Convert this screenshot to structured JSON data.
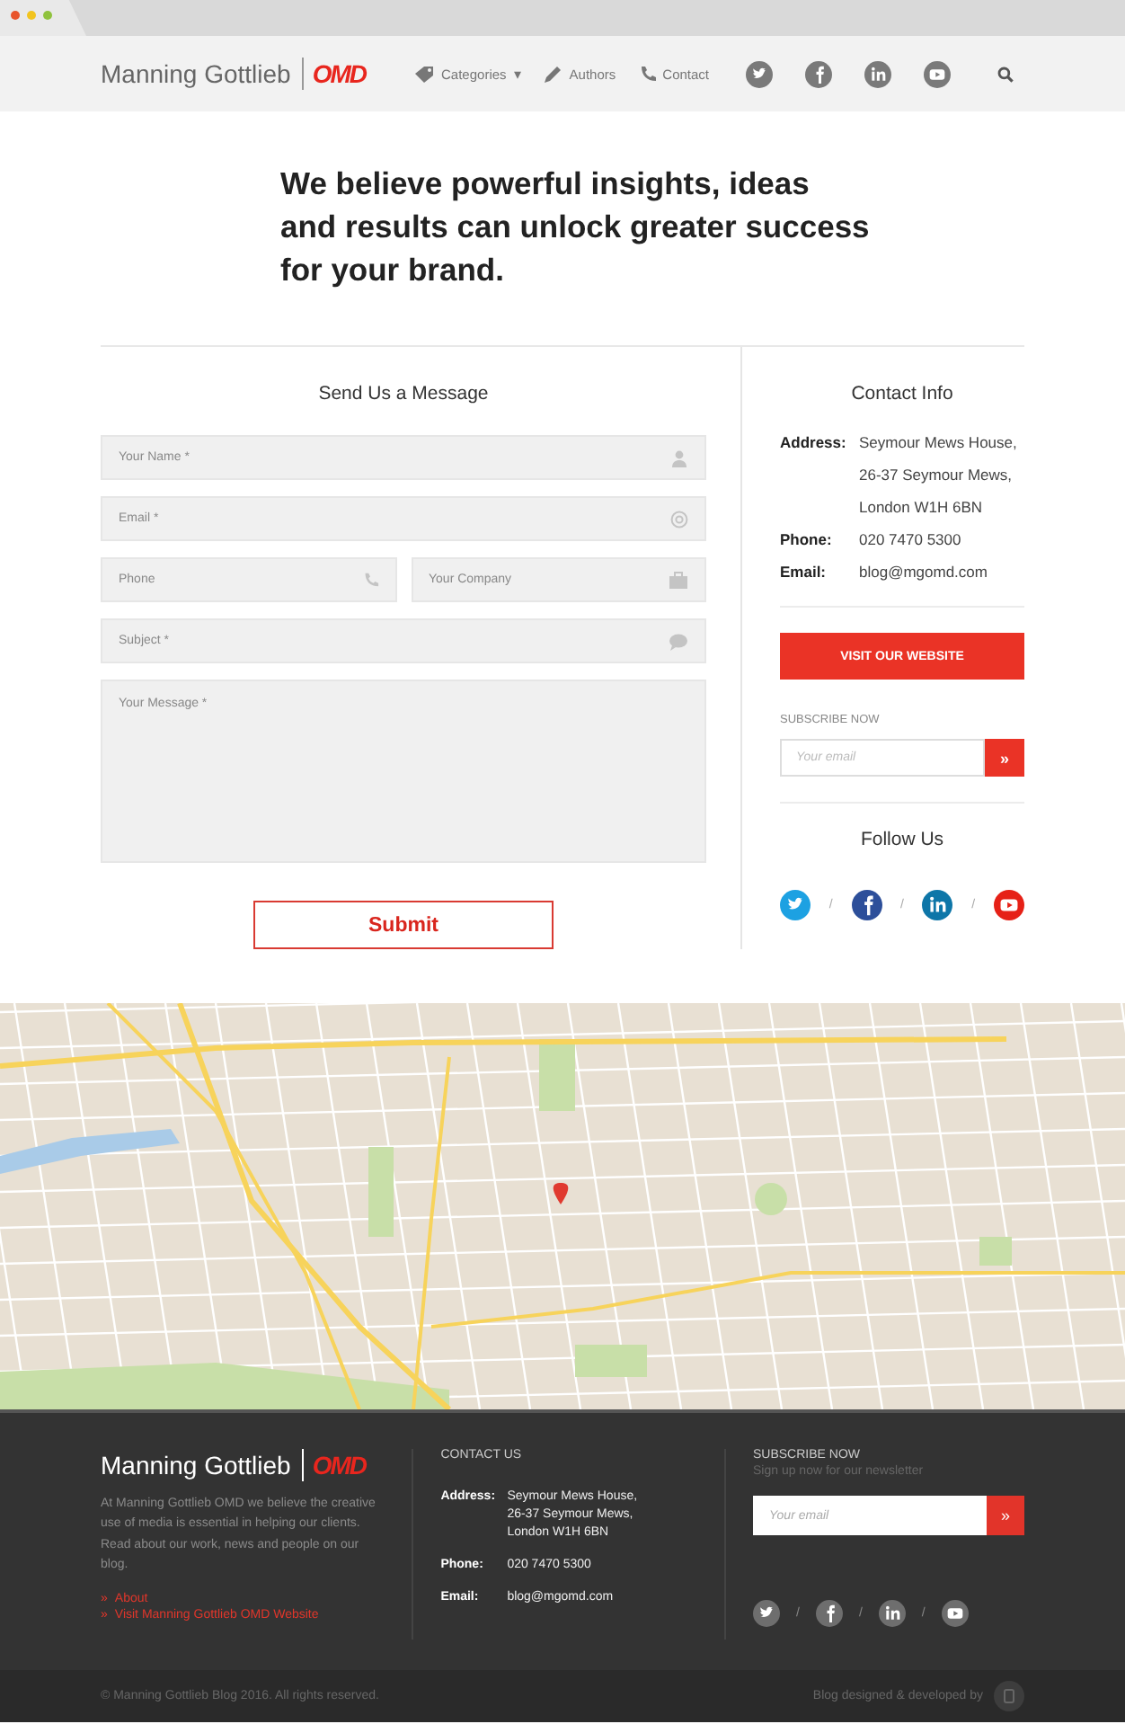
{
  "header": {
    "brand": "Manning Gottlieb",
    "logo": "OMD",
    "nav": [
      {
        "label": "Categories",
        "kind": "tag",
        "caret": "▾"
      },
      {
        "label": "Authors",
        "kind": "pen"
      },
      {
        "label": "Contact",
        "kind": "phone"
      }
    ],
    "socials": [
      {
        "kind": "twitter"
      },
      {
        "kind": "facebook"
      },
      {
        "kind": "linkedin"
      },
      {
        "kind": "youtube"
      }
    ]
  },
  "headline": "We believe powerful insights, ideas and results can unlock greater success for your brand.",
  "form": {
    "title": "Send Us a Message",
    "rows": [
      [
        {
          "placeholder": "Your Name *",
          "kind": "person"
        }
      ],
      [
        {
          "placeholder": "Email *",
          "kind": "at"
        }
      ],
      [
        {
          "placeholder": "Phone",
          "kind": "phone"
        },
        {
          "placeholder": "Your Company",
          "kind": "briefcase"
        }
      ],
      [
        {
          "placeholder": "Subject *",
          "kind": "bubble"
        }
      ],
      [
        {
          "placeholder": "Your Message *",
          "kind": "message"
        }
      ]
    ],
    "submit": "Submit"
  },
  "contact": {
    "title": "Contact Info",
    "details": [
      {
        "label": "Address:",
        "lines": [
          "Seymour Mews House,",
          "26-37 Seymour Mews,",
          "London W1H 6BN"
        ]
      },
      {
        "label": "Phone:",
        "lines": [
          "020 7470 5300"
        ]
      },
      {
        "label": "Email:",
        "lines": [
          "blog@mgomd.com"
        ]
      }
    ],
    "button": "VISIT OUR WEBSITE",
    "subscribe_label": "SUBSCRIBE NOW",
    "email_placeholder": "Your email",
    "send": "»",
    "follow_title": "Follow Us",
    "separator": "/",
    "socials": [
      {
        "kind": "twitter"
      },
      {
        "kind": "facebook"
      },
      {
        "kind": "linkedin"
      },
      {
        "kind": "youtube"
      }
    ]
  },
  "footer": {
    "brand": "Manning Gottlieb",
    "logo": "OMD",
    "about": "At Manning Gottlieb OMD we believe the creative use of media is essential in helping our clients. Read about our work, news and people on our blog.",
    "links": [
      {
        "marker": "»",
        "label": "About"
      },
      {
        "marker": "»",
        "label": "Visit Manning Gottlieb OMD Website"
      }
    ],
    "contact_title": "CONTACT US",
    "details": [
      {
        "label": "Address:",
        "lines": [
          "Seymour Mews House,",
          "26-37 Seymour Mews,",
          "London W1H 6BN"
        ]
      },
      {
        "label": "Phone:",
        "lines": [
          "020 7470 5300"
        ]
      },
      {
        "label": "Email:",
        "lines": [
          "blog@mgomd.com"
        ]
      }
    ],
    "subscribe_title": "SUBSCRIBE NOW",
    "subscribe_text": "Sign up now for our newsletter",
    "email_placeholder": "Your email",
    "send": "»",
    "separator": "/",
    "socials": [
      {
        "kind": "twitter"
      },
      {
        "kind": "facebook"
      },
      {
        "kind": "linkedin"
      },
      {
        "kind": "youtube"
      }
    ],
    "copyright": "© Manning Gottlieb Blog 2016. All rights reserved.",
    "credit": "Blog designed & developed by"
  }
}
